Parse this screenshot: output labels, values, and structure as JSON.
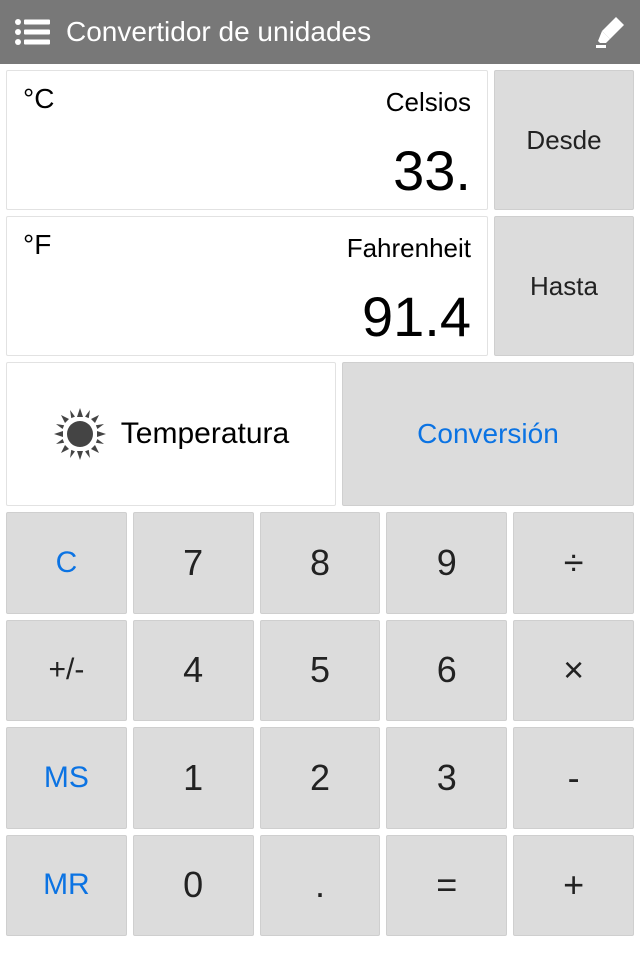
{
  "header": {
    "title": "Convertidor de unidades"
  },
  "from": {
    "symbol": "°C",
    "name": "Celsios",
    "value": "33.",
    "button": "Desde"
  },
  "to": {
    "symbol": "°F",
    "name": "Fahrenheit",
    "value": "91.4",
    "button": "Hasta"
  },
  "category": {
    "label": "Temperatura"
  },
  "conversion_button": "Conversión",
  "keys": {
    "clear": "C",
    "k7": "7",
    "k8": "8",
    "k9": "9",
    "div": "÷",
    "neg": "+/-",
    "k4": "4",
    "k5": "5",
    "k6": "6",
    "mul": "×",
    "ms": "MS",
    "k1": "1",
    "k2": "2",
    "k3": "3",
    "sub": "-",
    "mr": "MR",
    "k0": "0",
    "dot": ".",
    "eq": "=",
    "add": "+"
  }
}
